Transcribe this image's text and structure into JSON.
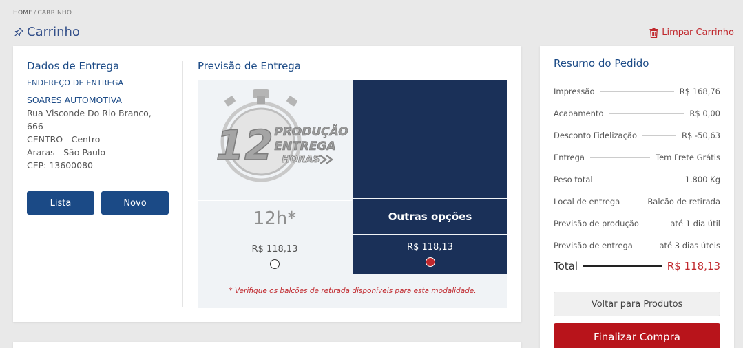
{
  "breadcrumb": {
    "home": "HOME",
    "separator": "/",
    "current": "CARRINHO"
  },
  "page": {
    "title": "Carrinho",
    "clear_cart": "Limpar Carrinho"
  },
  "delivery_data": {
    "title": "Dados de Entrega",
    "subtitle": "ENDEREÇO DE ENTREGA",
    "company": "SOARES AUTOMOTIVA",
    "address_lines": [
      "Rua Visconde Do Rio Branco,",
      "666",
      "CENTRO - Centro",
      "Araras - São Paulo",
      "CEP: 13600080"
    ],
    "buttons": {
      "list": "Lista",
      "new": "Novo"
    }
  },
  "forecast": {
    "title": "Previsão de Entrega",
    "badge_text": {
      "number": "12",
      "line1": "PRODUÇÃO",
      "line2": "ENTREGA",
      "line3": "HORAS"
    },
    "options": [
      {
        "label": "12h*",
        "price": "R$ 118,13",
        "selected": false
      },
      {
        "label": "Outras opções",
        "price": "R$ 118,13",
        "selected": true
      }
    ],
    "note": "* Verifique os balcões de retirada disponíveis para esta modalidade."
  },
  "summary": {
    "title": "Resumo do Pedido",
    "rows": [
      {
        "label": "Impressão",
        "value": "R$ 168,76"
      },
      {
        "label": "Acabamento",
        "value": "R$ 0,00"
      },
      {
        "label": "Desconto Fidelização",
        "value": "R$ -50,63"
      },
      {
        "label": "Entrega",
        "value": "Tem Frete Grátis"
      },
      {
        "label": "Peso total",
        "value": "1.800 Kg"
      },
      {
        "label": "Local de entrega",
        "value": "Balcão de retirada"
      },
      {
        "label": "Previsão de produção",
        "value": "até 1 dia útil"
      },
      {
        "label": "Previsão de entrega",
        "value": "até 3 dias úteis"
      }
    ],
    "total_label": "Total",
    "total_value": "R$ 118,13",
    "back_button": "Voltar para Produtos",
    "checkout_button": "Finalizar Compra"
  },
  "colors": {
    "primary": "#1b4a86",
    "dark_navy": "#1a3058",
    "accent_red": "#c0282d",
    "checkout_red": "#b8141b"
  },
  "icons": {
    "title": "pin-icon",
    "clear": "trash-icon",
    "badge": "stopwatch-icon"
  }
}
